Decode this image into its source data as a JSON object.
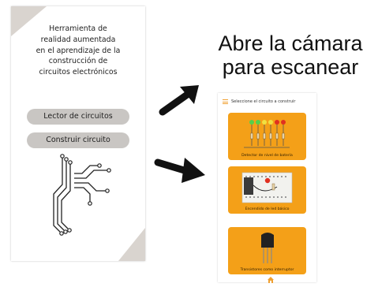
{
  "left_screen": {
    "title_lines": [
      "Herramienta de",
      "realidad aumentada",
      "en el aprendizaje de la",
      "construcción de",
      "circuitos electrónicos"
    ],
    "buttons": {
      "circuit_reader": "Lector de circuitos",
      "build_circuit": "Construir circuito"
    }
  },
  "caption": {
    "line1": "Abre la cámara",
    "line2": "para escanear"
  },
  "right_screen": {
    "header": "Seleccione el circuito a construir",
    "cards": [
      {
        "label": "Detector de nivel de batería"
      },
      {
        "label": "Encendido de led básico"
      },
      {
        "label": "Transistores como interruptor"
      }
    ]
  },
  "colors": {
    "card_orange": "#f4a018",
    "button_gray": "#c9c6c3",
    "corner_beige": "#d9d4cf",
    "accent_orange": "#f0a030"
  },
  "icons": [
    "menu-icon",
    "home-icon",
    "arrow-icon",
    "circuit-trace-icon"
  ]
}
